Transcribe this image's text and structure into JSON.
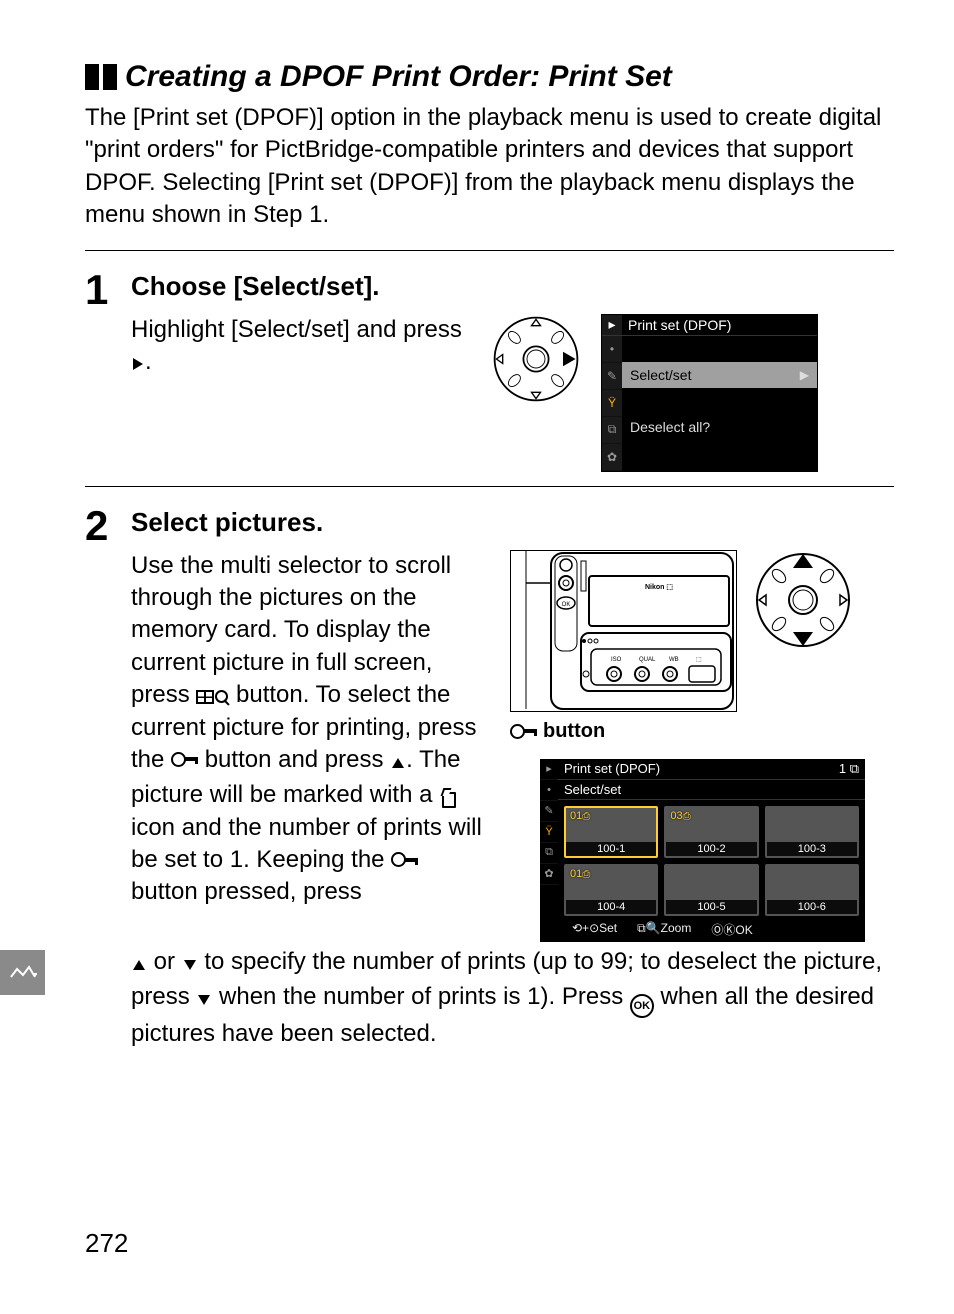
{
  "page_number": "272",
  "section_title": "Creating a DPOF Print Order: Print Set",
  "intro_text": "The [Print set (DPOF)] option in the playback menu is used to create digital \"print orders\" for PictBridge-compatible printers and devices that support DPOF.  Selecting [Print set (DPOF)] from the playback menu displays the menu shown in Step 1.",
  "step1": {
    "number": "1",
    "heading": "Choose [Select/set].",
    "text_before": "Highlight [Select/set] and press ",
    "text_after": "."
  },
  "lcd1": {
    "title": "Print set (DPOF)",
    "rows": [
      "",
      "Select/set",
      "",
      "Deselect all?",
      ""
    ],
    "selected_index": 1
  },
  "step2": {
    "number": "2",
    "heading": "Select pictures.",
    "para_a": "Use the multi selector to scroll through the pictures on the memory card.  To display the current picture in full screen, press ",
    "para_b": " button.  To select the current picture for printing, press the ",
    "para_c": " button and press ",
    "para_d": ".  The picture will be marked with a ",
    "para_e": " icon and the number of prints will be set to 1.  Keeping the ",
    "para_f": " button pressed, press ",
    "para_g": " or ",
    "para_h": " to specify the number of prints (up to 99; to deselect the picture, press ",
    "para_i": " when the number of prints is 1).  Press ",
    "para_j": " when all the desired pictures have been selected."
  },
  "caption2": " button",
  "lcd2": {
    "title": "Print set (DPOF)",
    "subtitle": "Select/set",
    "badge": "1",
    "thumbs": [
      {
        "tag": "01",
        "marked": true,
        "file": "100-1",
        "selected": true
      },
      {
        "tag": "03",
        "marked": true,
        "file": "100-2",
        "selected": false
      },
      {
        "tag": "",
        "marked": false,
        "file": "100-3",
        "selected": false
      },
      {
        "tag": "01",
        "marked": true,
        "file": "100-4",
        "selected": false
      },
      {
        "tag": "",
        "marked": false,
        "file": "100-5",
        "selected": false
      },
      {
        "tag": "",
        "marked": false,
        "file": "100-6",
        "selected": false
      }
    ],
    "hints": [
      "Set",
      "Zoom",
      "OK"
    ]
  }
}
